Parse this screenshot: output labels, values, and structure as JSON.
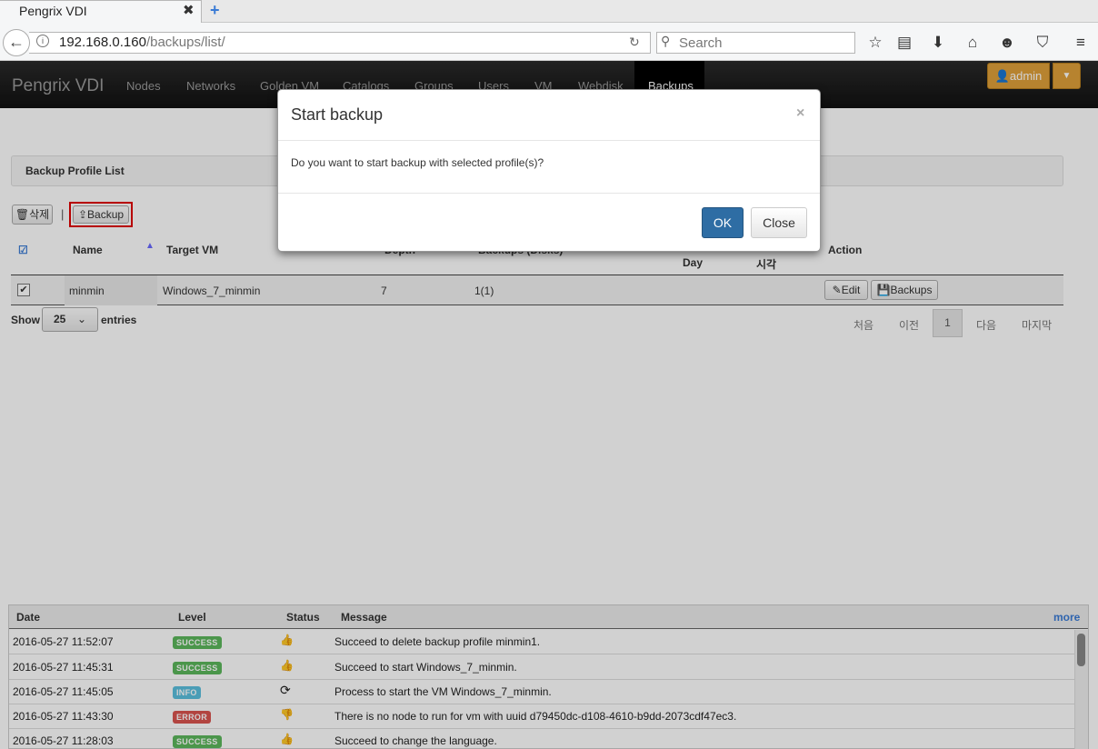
{
  "browser": {
    "tab_title": "Pengrix VDI",
    "url_host": "192.168.0.160",
    "url_path": "/backups/list/",
    "search_placeholder": "Search"
  },
  "app": {
    "brand": "Pengrix VDI",
    "nav": [
      "Nodes",
      "Networks",
      "Golden VM",
      "Catalogs",
      "Groups",
      "Users",
      "VM",
      "Webdisk",
      "Backups"
    ],
    "active_nav": "Backups",
    "user": "admin"
  },
  "page": {
    "panel_title": "Backup Profile List",
    "delete_label": "삭제",
    "backup_label": "Backup",
    "columns": {
      "name": "Name",
      "target_vm": "Target VM",
      "depth": "Depth",
      "backups": "Backups (Disks)",
      "day": "Day",
      "time": "시각",
      "action": "Action"
    },
    "rows": [
      {
        "name": "minmin",
        "target_vm": "Windows_7_minmin",
        "depth": "7",
        "backups": "1(1)",
        "edit": "Edit",
        "backups_btn": "Backups"
      }
    ],
    "show": "Show",
    "page_size": "25",
    "entries": "entries",
    "pager": {
      "first": "처음",
      "prev": "이전",
      "current": "1",
      "next": "다음",
      "last": "마지막"
    }
  },
  "modal": {
    "title": "Start backup",
    "close_x": "×",
    "body": "Do you want to start backup with selected profile(s)?",
    "ok": "OK",
    "close": "Close"
  },
  "log": {
    "headers": {
      "date": "Date",
      "level": "Level",
      "status": "Status",
      "message": "Message"
    },
    "more": "more",
    "rows": [
      {
        "date": "2016-05-27 11:52:07",
        "level": "SUCCESS",
        "color": "#5cb85c",
        "icon": "thumbs-up-icon",
        "message": "Succeed to delete backup profile minmin1."
      },
      {
        "date": "2016-05-27 11:45:31",
        "level": "SUCCESS",
        "color": "#5cb85c",
        "icon": "thumbs-up-icon",
        "message": "Succeed to start Windows_7_minmin."
      },
      {
        "date": "2016-05-27 11:45:05",
        "level": "INFO",
        "color": "#5bc0de",
        "icon": "refresh-icon",
        "message": "Process to start the VM Windows_7_minmin."
      },
      {
        "date": "2016-05-27 11:43:30",
        "level": "ERROR",
        "color": "#d9534f",
        "icon": "thumbs-down-icon",
        "message": "There is no node to run for vm with uuid d79450dc-d108-4610-b9dd-2073cdf47ec3."
      },
      {
        "date": "2016-05-27 11:28:03",
        "level": "SUCCESS",
        "color": "#5cb85c",
        "icon": "thumbs-up-icon",
        "message": "Succeed to change the language."
      }
    ]
  }
}
